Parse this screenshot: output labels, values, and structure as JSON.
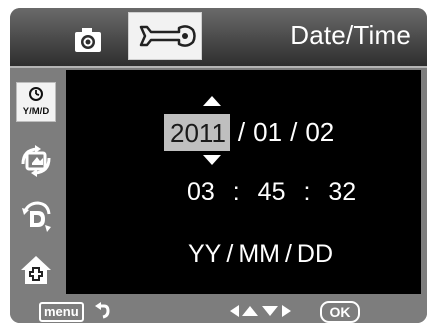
{
  "header": {
    "title": "Date/Time",
    "tabs": [
      {
        "icon": "camera-icon"
      },
      {
        "icon": "wrench-settings-icon",
        "active": true
      }
    ]
  },
  "sidebar": {
    "items": [
      {
        "icon": "date-format-icon",
        "label": "Y/M/D",
        "active": true
      },
      {
        "icon": "rotate-icon"
      },
      {
        "icon": "dial-icon"
      },
      {
        "icon": "home-reset-icon"
      }
    ]
  },
  "date": {
    "year": "2011",
    "month": "01",
    "day": "02",
    "separator": "/"
  },
  "time": {
    "hour": "03",
    "minute": "45",
    "second": "32",
    "separator": ":"
  },
  "format": {
    "y": "YY",
    "m": "MM",
    "d": "DD",
    "separator": "/"
  },
  "footer": {
    "menu_label": "menu",
    "ok_label": "OK"
  },
  "colors": {
    "frame": "#7d7d7d",
    "screen": "#000000",
    "highlight": "#bfbfbf",
    "text": "#ffffff"
  }
}
